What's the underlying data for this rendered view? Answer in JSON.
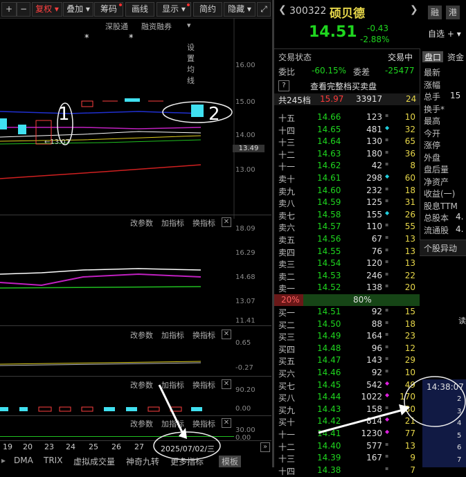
{
  "toolbar": {
    "items": [
      "复权",
      "叠加",
      "筹码",
      "画线",
      "显示",
      "简约",
      "隐藏"
    ],
    "selected": "复权"
  },
  "subbar": [
    "深股通",
    "融资融券",
    "设置均线"
  ],
  "price_axis": [
    "16.00",
    "15.00",
    "14.00",
    "13.49",
    "13.00"
  ],
  "annotations": {
    "label1": "1",
    "label2": "2",
    "low_marker": "←13.07"
  },
  "indicator_panels": [
    {
      "buttons": [
        "改参数",
        "加指标",
        "换指标"
      ],
      "axis": [
        "18.09",
        "16.29",
        "14.68",
        "13.07",
        "11.41"
      ]
    },
    {
      "buttons": [
        "改参数",
        "加指标",
        "换指标"
      ],
      "axis": [
        "0.65",
        "-0.27"
      ]
    },
    {
      "buttons": [
        "改参数",
        "加指标",
        "换指标"
      ],
      "axis": [
        "90.20",
        "0.00"
      ]
    },
    {
      "buttons": [
        "改参数",
        "加指标",
        "换指标"
      ],
      "axis": [
        "30.00",
        "0.00"
      ]
    }
  ],
  "date_axis": [
    "19",
    "20",
    "23",
    "24",
    "25",
    "26",
    "27"
  ],
  "date_box": "2025/07/02/三",
  "bottom_tabs": [
    "DMA",
    "TRIX",
    "虚拟成交量",
    "神奇九转",
    "更多指标",
    "模板"
  ],
  "stock": {
    "code": "300322",
    "name": "硕贝德",
    "price": "14.51",
    "change": "-0.43",
    "pct": "-2.88%",
    "tag1": "融",
    "tag2": "港",
    "watch": "自选"
  },
  "status": {
    "label": "交易状态",
    "value": "交易中",
    "weibi_label": "委比",
    "weibi": "-60.15%",
    "weicha_label": "委差",
    "weicha": "-25477",
    "full_book": "查看完整档买卖盘",
    "total_label": "共245档",
    "total_price": "15.97",
    "total_vol": "33917",
    "total_n": "24"
  },
  "right_tabs": [
    "盘口",
    "资金"
  ],
  "right_labels": [
    "最新",
    "涨幅",
    "总手",
    "换手*",
    "最高",
    "今开",
    "涨停",
    "外盘",
    "盘后量",
    "净资产",
    "收益(一)",
    "股息TTM",
    "总股本",
    "流通股"
  ],
  "right_values": {
    "zongshou": "15",
    "zongguben": "4.",
    "liutong": "4."
  },
  "asks": [
    {
      "l": "十五",
      "p": "14.66",
      "v": "123",
      "d": "",
      "n": "10"
    },
    {
      "l": "十四",
      "p": "14.65",
      "v": "481",
      "d": "c",
      "n": "32"
    },
    {
      "l": "十三",
      "p": "14.64",
      "v": "130",
      "d": "",
      "n": "65"
    },
    {
      "l": "十二",
      "p": "14.63",
      "v": "180",
      "d": "",
      "n": "36"
    },
    {
      "l": "十一",
      "p": "14.62",
      "v": "42",
      "d": "",
      "n": "8"
    },
    {
      "l": "卖十",
      "p": "14.61",
      "v": "298",
      "d": "c",
      "n": "60"
    },
    {
      "l": "卖九",
      "p": "14.60",
      "v": "232",
      "d": "",
      "n": "18"
    },
    {
      "l": "卖八",
      "p": "14.59",
      "v": "125",
      "d": "",
      "n": "31"
    },
    {
      "l": "卖七",
      "p": "14.58",
      "v": "155",
      "d": "c",
      "n": "26"
    },
    {
      "l": "卖六",
      "p": "14.57",
      "v": "110",
      "d": "",
      "n": "55"
    },
    {
      "l": "卖五",
      "p": "14.56",
      "v": "67",
      "d": "",
      "n": "13"
    },
    {
      "l": "卖四",
      "p": "14.55",
      "v": "76",
      "d": "",
      "n": "13"
    },
    {
      "l": "卖三",
      "p": "14.54",
      "v": "120",
      "d": "",
      "n": "13"
    },
    {
      "l": "卖二",
      "p": "14.53",
      "v": "246",
      "d": "",
      "n": "22"
    },
    {
      "l": "卖一",
      "p": "14.52",
      "v": "138",
      "d": "",
      "n": "20"
    }
  ],
  "ratio": {
    "left": "20%",
    "right": "80%"
  },
  "bids": [
    {
      "l": "买一",
      "p": "14.51",
      "v": "92",
      "d": "",
      "n": "15"
    },
    {
      "l": "买二",
      "p": "14.50",
      "v": "88",
      "d": "",
      "n": "18"
    },
    {
      "l": "买三",
      "p": "14.49",
      "v": "164",
      "d": "",
      "n": "23"
    },
    {
      "l": "买四",
      "p": "14.48",
      "v": "96",
      "d": "",
      "n": "12"
    },
    {
      "l": "买五",
      "p": "14.47",
      "v": "143",
      "d": "",
      "n": "29"
    },
    {
      "l": "买六",
      "p": "14.46",
      "v": "92",
      "d": "",
      "n": "10"
    },
    {
      "l": "买七",
      "p": "14.45",
      "v": "542",
      "d": "m",
      "n": "49"
    },
    {
      "l": "买八",
      "p": "14.44",
      "v": "1022",
      "d": "m",
      "n": "170"
    },
    {
      "l": "买九",
      "p": "14.43",
      "v": "158",
      "d": "",
      "n": "30"
    },
    {
      "l": "买十",
      "p": "14.42",
      "v": "814",
      "d": "m",
      "n": "21"
    },
    {
      "l": "十一",
      "p": "14.41",
      "v": "1230",
      "d": "m",
      "n": "77"
    },
    {
      "l": "十二",
      "p": "14.40",
      "v": "577",
      "d": "",
      "n": "13"
    },
    {
      "l": "十三",
      "p": "14.39",
      "v": "167",
      "d": "",
      "n": "9"
    },
    {
      "l": "十四",
      "p": "14.38",
      "v": "",
      "d": "",
      "n": "7"
    }
  ],
  "abnormal_tab": "个股异动",
  "cut_text": "读",
  "time_panel": {
    "time": "14:38:07",
    "rows": [
      "2",
      "3",
      "4",
      "5",
      "6",
      "7"
    ]
  }
}
